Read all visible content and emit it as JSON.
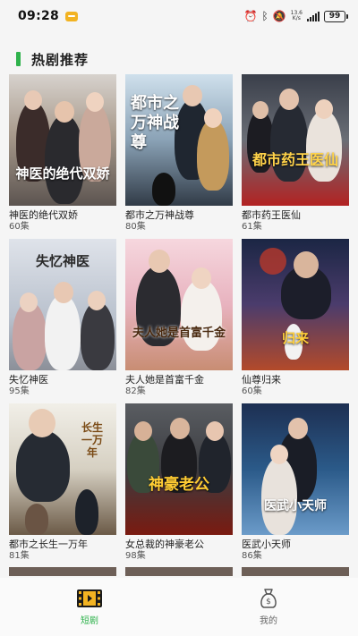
{
  "status_bar": {
    "time": "09:28",
    "net_speed_value": "13.6",
    "net_speed_unit": "K/s",
    "battery": "99"
  },
  "section": {
    "title": "热剧推荐"
  },
  "dramas": [
    {
      "title": "神医的绝代双娇",
      "episodes": "60集",
      "poster_text": "神医的绝代双娇"
    },
    {
      "title": "都市之万神战尊",
      "episodes": "80集",
      "poster_text": "都市之万神战尊"
    },
    {
      "title": "都市药王医仙",
      "episodes": "61集",
      "poster_text": "都市药王医仙"
    },
    {
      "title": "失忆神医",
      "episodes": "95集",
      "poster_text": "失忆神医"
    },
    {
      "title": "夫人她是首富千金",
      "episodes": "82集",
      "poster_text": "夫人她是首富千金"
    },
    {
      "title": "仙尊归来",
      "episodes": "60集",
      "poster_text": "归来"
    },
    {
      "title": "都市之长生一万年",
      "episodes": "81集",
      "poster_text": "长生一万年"
    },
    {
      "title": "女总裁的神豪老公",
      "episodes": "98集",
      "poster_text": "神豪老公"
    },
    {
      "title": "医武小天师",
      "episodes": "86集",
      "poster_text": "医武小天师"
    }
  ],
  "bottom_nav": {
    "items": [
      {
        "label": "短剧",
        "icon": "film-icon",
        "active": true
      },
      {
        "label": "我的",
        "icon": "money-bag-icon",
        "active": false
      }
    ]
  },
  "colors": {
    "accent": "#2fb24c",
    "background": "#f5f5f5"
  }
}
